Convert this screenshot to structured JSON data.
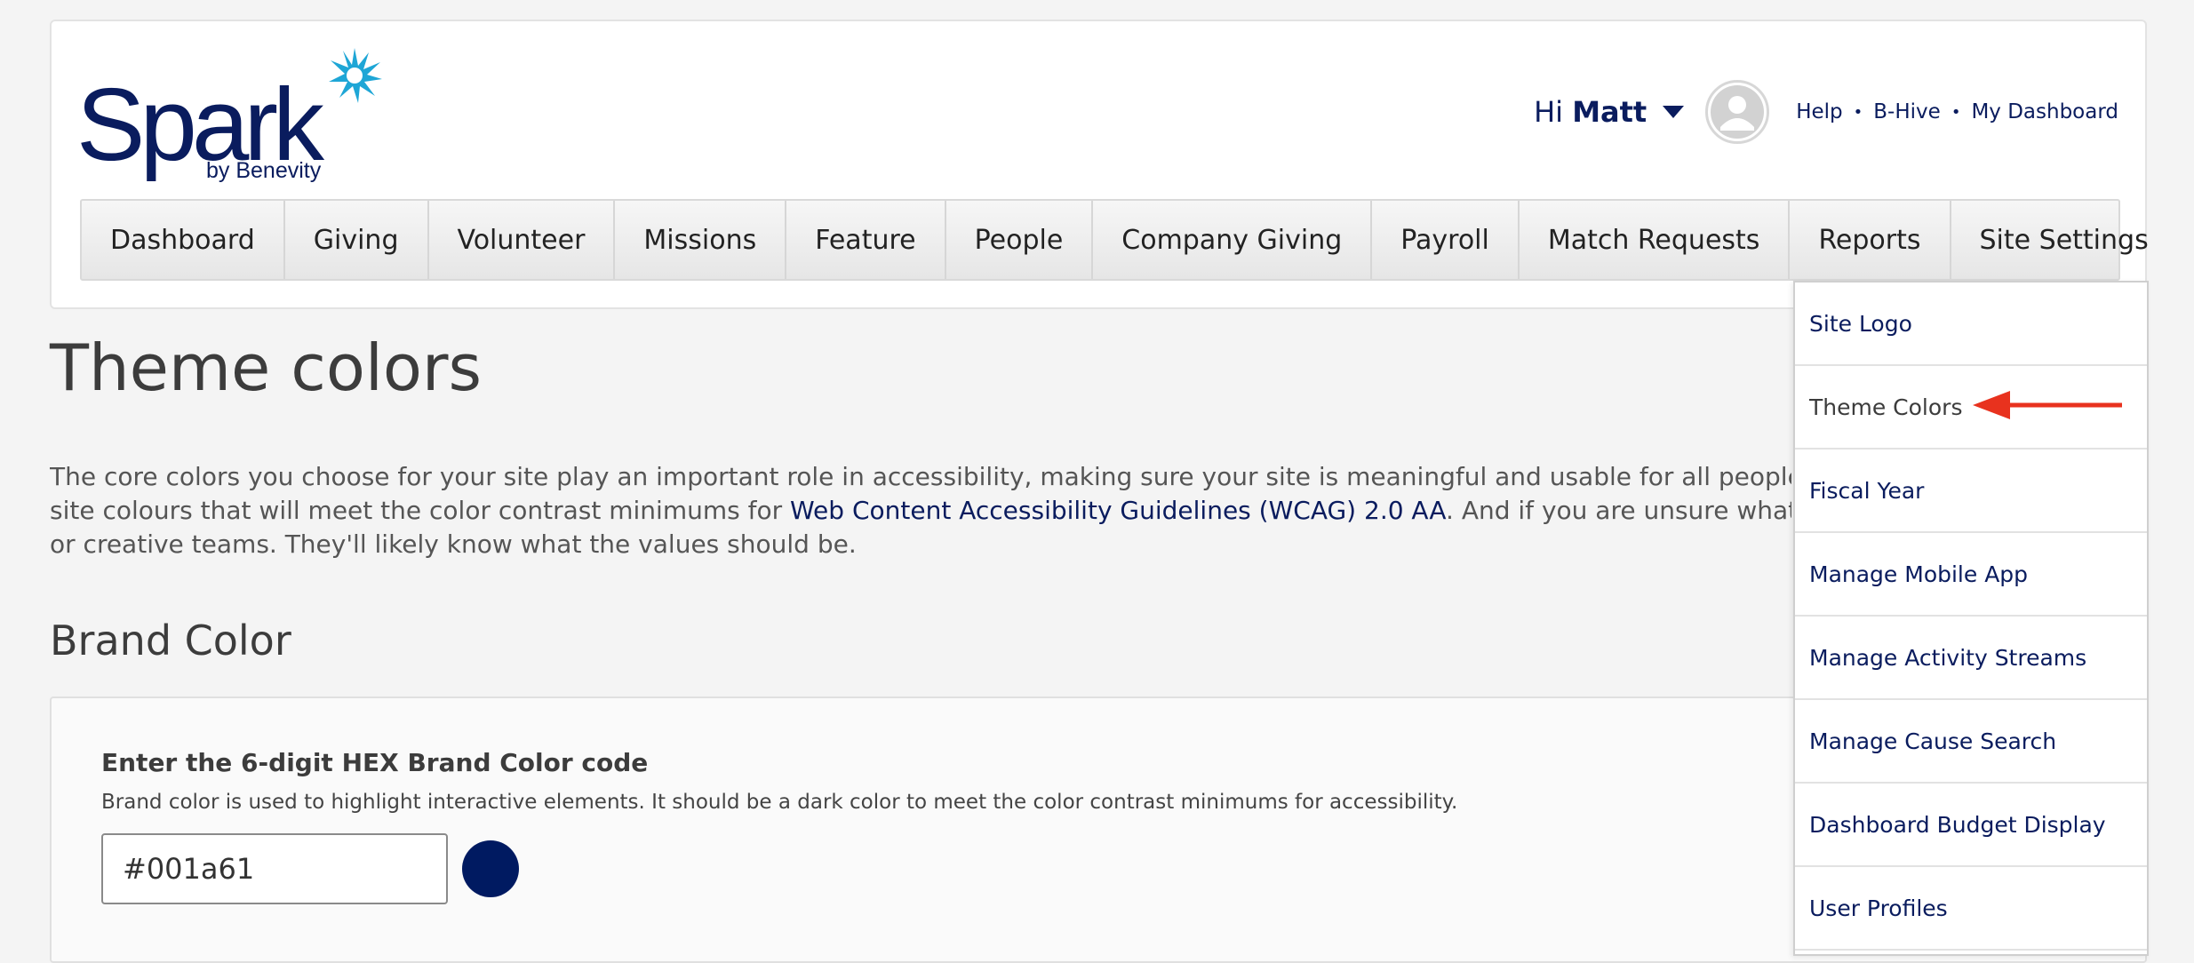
{
  "brand": {
    "name": "Spark",
    "byline": "by Benevity",
    "logo_color": "#0a1c5e",
    "star_color": "#1ea6d6"
  },
  "user": {
    "greeting": "Hi",
    "name": "Matt"
  },
  "top_links": [
    "Help",
    "B-Hive",
    "My Dashboard"
  ],
  "nav": {
    "items": [
      "Dashboard",
      "Giving",
      "Volunteer",
      "Missions",
      "Feature",
      "People",
      "Company Giving",
      "Payroll",
      "Match Requests",
      "Reports",
      "Site Settings"
    ],
    "active": "Site Settings"
  },
  "page": {
    "title": "Theme colors",
    "intro_line1": "The core colors you choose for your site play an important role in accessibility, making sure your site is meaningful and usable for all people. Work thro",
    "intro_line2_pre": "site colours that will meet the color contrast minimums for ",
    "intro_link": "Web Content Accessibility Guidelines (WCAG) 2.0 AA",
    "intro_line2_post": ". And if you are unsure what values to ad",
    "intro_line3": "or creative teams. They'll likely know what the values should be."
  },
  "brand_color": {
    "section_title": "Brand Color",
    "label": "Enter the 6-digit HEX Brand Color code",
    "help": "Brand color is used to highlight interactive elements. It should be a dark color to meet the color contrast minimums for accessibility.",
    "value": "#001a61",
    "swatch": "#001a61"
  },
  "site_settings_menu": {
    "items": [
      "Site Logo",
      "Theme Colors",
      "Fiscal Year",
      "Manage Mobile App",
      "Manage Activity Streams",
      "Manage Cause Search",
      "Dashboard Budget Display",
      "User Profiles"
    ],
    "selected": "Theme Colors",
    "annotation_arrow_color": "#e8321e"
  }
}
